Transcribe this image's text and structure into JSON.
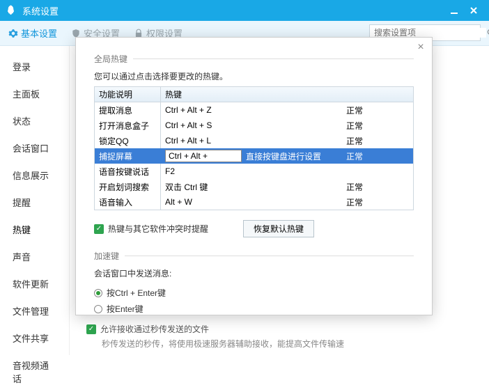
{
  "window": {
    "title": "系统设置"
  },
  "toolbar": {
    "t1": "基本设置",
    "t2": "安全设置",
    "t3": "权限设置",
    "search_placeholder": "搜索设置项"
  },
  "sidebar": {
    "items": [
      "登录",
      "主面板",
      "状态",
      "会话窗口",
      "信息展示",
      "提醒",
      "热键",
      "声音",
      "软件更新",
      "文件管理",
      "文件共享",
      "音视频通话"
    ],
    "active_index": 6
  },
  "bg": {
    "check_label": "允许接收通过秒传发送的文件",
    "desc": "秒传发送的秒传，将使用极速服务器辅助接收，能提高文件传输速"
  },
  "modal": {
    "section1": "全局热键",
    "hint": "您可以通过点击选择要更改的热键。",
    "col1": "功能说明",
    "col2": "热键",
    "rows": [
      {
        "name": "提取消息",
        "key": "Ctrl + Alt + Z",
        "status": "正常"
      },
      {
        "name": "打开消息盒子",
        "key": "Ctrl + Alt + S",
        "status": "正常"
      },
      {
        "name": "锁定QQ",
        "key": "Ctrl + Alt + L",
        "status": "正常"
      },
      {
        "name": "捕捉屏幕",
        "key": "Ctrl + Alt + ",
        "status": "正常",
        "editing": true,
        "edit_hint": "直接按键盘进行设置"
      },
      {
        "name": "语音按键说话",
        "key": "F2",
        "status": ""
      },
      {
        "name": "开启划词搜索",
        "key": "双击 Ctrl 键",
        "status": "正常"
      },
      {
        "name": "语音输入",
        "key": "Alt + W",
        "status": "正常"
      }
    ],
    "conflict_label": "热键与其它软件冲突时提醒",
    "reset_btn": "恢复默认热键",
    "section2": "加速键",
    "send_label": "会话窗口中发送消息:",
    "radio1": "按Ctrl + Enter键",
    "radio2": "按Enter键"
  }
}
